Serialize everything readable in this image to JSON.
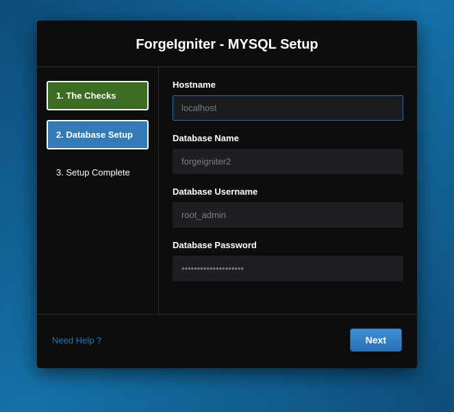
{
  "header": {
    "title": "ForgeIgniter - MYSQL Setup"
  },
  "sidebar": {
    "steps": [
      {
        "label": "1. The Checks"
      },
      {
        "label": "2. Database Setup"
      },
      {
        "label": "3. Setup Complete"
      }
    ]
  },
  "form": {
    "hostname": {
      "label": "Hostname",
      "value": "localhost"
    },
    "dbname": {
      "label": "Database Name",
      "value": "forgeigniter2"
    },
    "dbuser": {
      "label": "Database Username",
      "value": "root_admin"
    },
    "dbpass": {
      "label": "Database Password",
      "value": "••••••••••••••••••••"
    }
  },
  "footer": {
    "help": "Need Help ?",
    "next": "Next"
  }
}
